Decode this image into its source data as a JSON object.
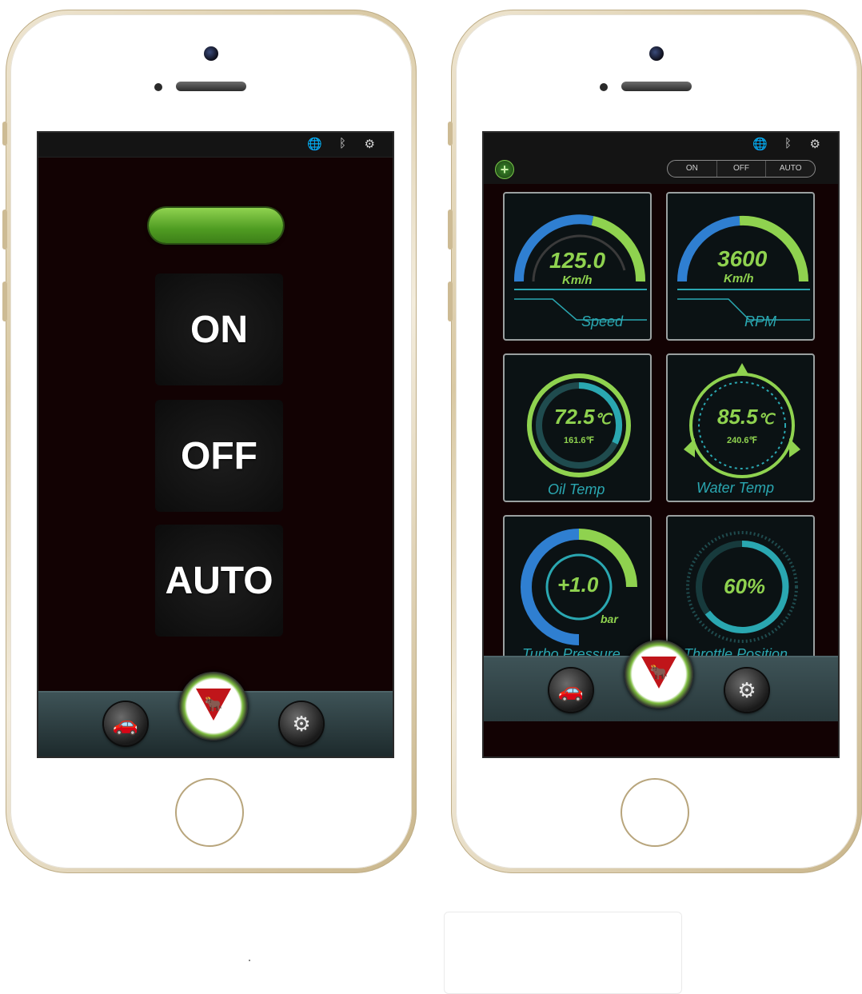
{
  "left_phone": {
    "status_icons": [
      "globe-icon",
      "bluetooth-icon",
      "engine-icon"
    ],
    "buttons": {
      "on": "ON",
      "off": "OFF",
      "auto": "AUTO"
    },
    "indicator_color": "#5fae2e",
    "nav": [
      "car-icon",
      "logo",
      "settings-icon"
    ]
  },
  "right_phone": {
    "status_icons": [
      "globe-icon",
      "bluetooth-icon",
      "engine-icon"
    ],
    "toolbar": {
      "add_label": "+",
      "segments": [
        "ON",
        "OFF",
        "AUTO"
      ]
    },
    "gauges": {
      "speed": {
        "value": "125.0",
        "unit": "Km/h",
        "label": "Speed"
      },
      "rpm": {
        "value": "3600",
        "unit": "Km/h",
        "label": "RPM"
      },
      "oil": {
        "value": "72.5",
        "unit_c": "℃",
        "sub": "161.6",
        "unit_f": "℉",
        "label": "Oil Temp"
      },
      "water": {
        "value": "85.5",
        "unit_c": "℃",
        "sub": "240.6",
        "unit_f": "℉",
        "label": "Water Temp"
      },
      "turbo": {
        "value": "+1.0",
        "unit": "bar",
        "label": "Turbo Pressure"
      },
      "throttle": {
        "value": "60%",
        "label": "Throttle Position"
      }
    },
    "nav": [
      "car-icon",
      "logo",
      "settings-icon"
    ]
  },
  "colors": {
    "accent_green": "#8fd24f",
    "accent_blue": "#2f7fd1",
    "accent_teal": "#2aa7b1",
    "screen_bg": "#120203"
  }
}
